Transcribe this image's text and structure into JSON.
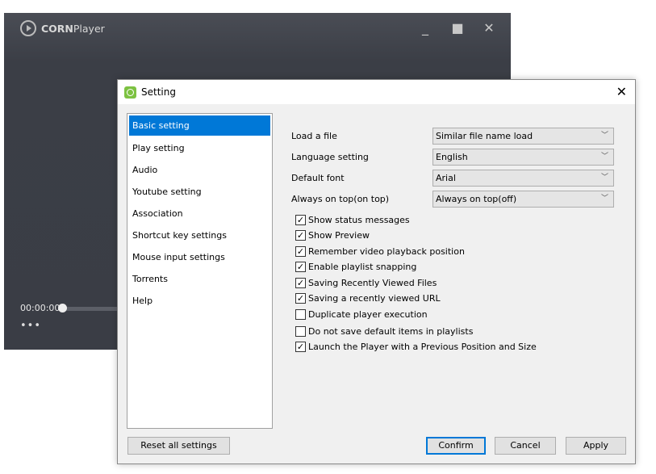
{
  "player": {
    "brand_bold": "CORN",
    "brand_rest": "Player",
    "time": "00:00:00",
    "more": "•••"
  },
  "dialog": {
    "title": "Setting",
    "sidebar": [
      "Basic setting",
      "Play setting",
      "Audio",
      "Youtube setting",
      "Association",
      "Shortcut key settings",
      "Mouse input settings",
      "Torrents",
      "Help"
    ],
    "settings": [
      {
        "label": "Load a file",
        "value": "Similar file name load"
      },
      {
        "label": "Language setting",
        "value": "English"
      },
      {
        "label": "Default font",
        "value": "Arial"
      },
      {
        "label": "Always on top(on top)",
        "value": "Always on top(off)"
      }
    ],
    "checkboxes": [
      {
        "label": "Show status messages",
        "checked": true
      },
      {
        "label": "Show Preview",
        "checked": true
      },
      {
        "label": "Remember video playback position",
        "checked": true
      },
      {
        "label": "Enable playlist snapping",
        "checked": true
      },
      {
        "label": "Saving Recently Viewed Files",
        "checked": true
      },
      {
        "label": "Saving a recently viewed URL",
        "checked": true
      },
      {
        "label": "Duplicate player execution",
        "checked": false
      },
      {
        "label": "Do not save default items in playlists",
        "checked": false
      },
      {
        "label": "Launch the Player with a Previous Position and Size",
        "checked": true
      }
    ],
    "buttons": {
      "reset": "Reset all settings",
      "confirm": "Confirm",
      "cancel": "Cancel",
      "apply": "Apply"
    }
  }
}
